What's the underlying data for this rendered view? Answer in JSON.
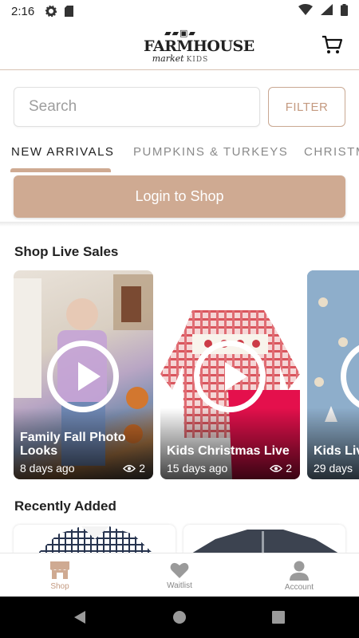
{
  "status_bar": {
    "time": "2:16"
  },
  "header": {
    "logo_train": "▰▰▣▰",
    "logo_brand": "FARMHOUSE",
    "logo_sub": "market",
    "logo_sub_kids": "KIDS"
  },
  "search": {
    "placeholder": "Search",
    "filter_label": "FILTER"
  },
  "tabs": [
    {
      "label": "NEW ARRIVALS"
    },
    {
      "label": "PUMPKINS & TURKEYS"
    },
    {
      "label": "CHRISTMAS"
    }
  ],
  "login_label": "Login to Shop",
  "live_sales": {
    "title": "Shop Live Sales",
    "items": [
      {
        "title": "Family Fall Photo Looks",
        "age": "8 days ago",
        "views": "2"
      },
      {
        "title": "Kids Christmas Live",
        "age": "15 days ago",
        "views": "2"
      },
      {
        "title": "Kids Live Me and",
        "age": "29 days",
        "views": ""
      }
    ]
  },
  "recently_added": {
    "title": "Recently Added"
  },
  "bottom_nav": [
    {
      "label": "Shop",
      "icon": "store-icon"
    },
    {
      "label": "Waitlist",
      "icon": "heart-icon"
    },
    {
      "label": "Account",
      "icon": "person-icon"
    }
  ],
  "colors": {
    "accent": "#cfaa92",
    "accent_text": "#c49a80"
  }
}
